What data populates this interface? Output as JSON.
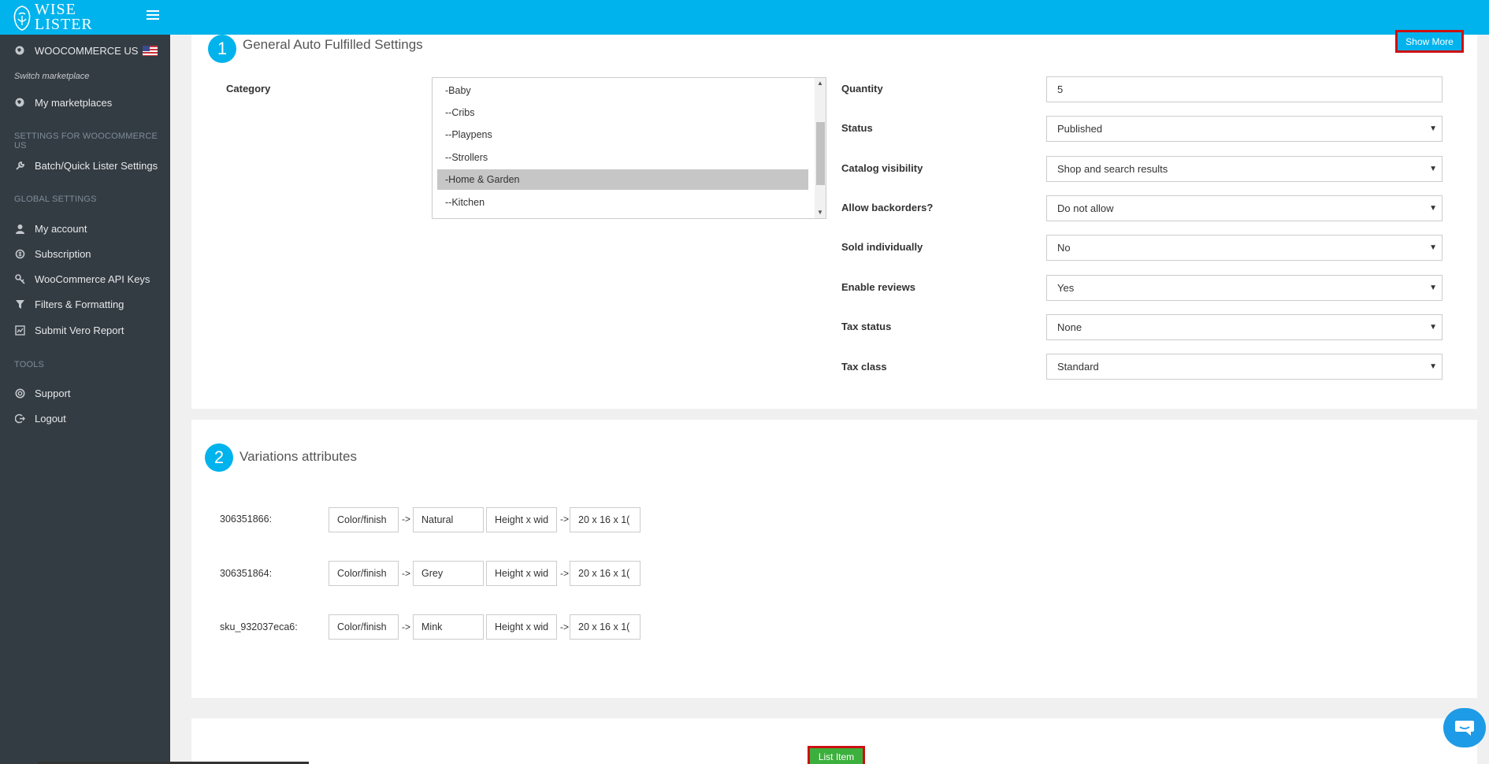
{
  "app": {
    "logo_line1": "WISE",
    "logo_line2": "LISTER"
  },
  "sidebar": {
    "marketplace": "WOOCOMMERCE US",
    "switch_marketplace": "Switch marketplace",
    "my_marketplaces": "My marketplaces",
    "settings_header": "SETTINGS FOR WOOCOMMERCE US",
    "batch_settings": "Batch/Quick Lister Settings",
    "global_header": "GLOBAL SETTINGS",
    "global_items": [
      "My account",
      "Subscription",
      "WooCommerce API Keys",
      "Filters & Formatting",
      "Submit Vero Report"
    ],
    "tools_header": "TOOLS",
    "tools_items": [
      "Support",
      "Logout"
    ]
  },
  "section1": {
    "number": "1",
    "title": "General Auto Fulfilled Settings",
    "show_more": "Show More",
    "category_label": "Category",
    "category_options": [
      "-Baby",
      "--Cribs",
      "--Playpens",
      "--Strollers",
      "-Home & Garden",
      "--Kitchen"
    ],
    "category_selected": "-Home & Garden",
    "fields": [
      {
        "label": "Quantity",
        "value": "5"
      },
      {
        "label": "Status",
        "value": "Published"
      },
      {
        "label": "Catalog visibility",
        "value": "Shop and search results"
      },
      {
        "label": "Allow backorders?",
        "value": "Do not allow"
      },
      {
        "label": "Sold individually",
        "value": "No"
      },
      {
        "label": "Enable reviews",
        "value": "Yes"
      },
      {
        "label": "Tax status",
        "value": "None"
      },
      {
        "label": "Tax class",
        "value": "Standard"
      }
    ]
  },
  "section2": {
    "number": "2",
    "title": "Variations attributes",
    "rows": [
      {
        "sku": "306351866:",
        "attr1": "Color/finish",
        "val1": "Natural",
        "attr2": "Height x wid",
        "val2": "20  x 16  x 1("
      },
      {
        "sku": "306351864:",
        "attr1": "Color/finish",
        "val1": "Grey",
        "attr2": "Height x wid",
        "val2": "20  x 16  x 1("
      },
      {
        "sku": "sku_932037eca6:",
        "attr1": "Color/finish",
        "val1": "Mink",
        "attr2": "Height x wid",
        "val2": "20  x 16  x 1("
      }
    ],
    "arrow": "->"
  },
  "actions": {
    "list_item": "List Item"
  },
  "colors": {
    "accent": "#00b3ec",
    "sidebar": "#343c43",
    "list_button": "#3cb03c",
    "highlight_border": "#cc1111"
  }
}
